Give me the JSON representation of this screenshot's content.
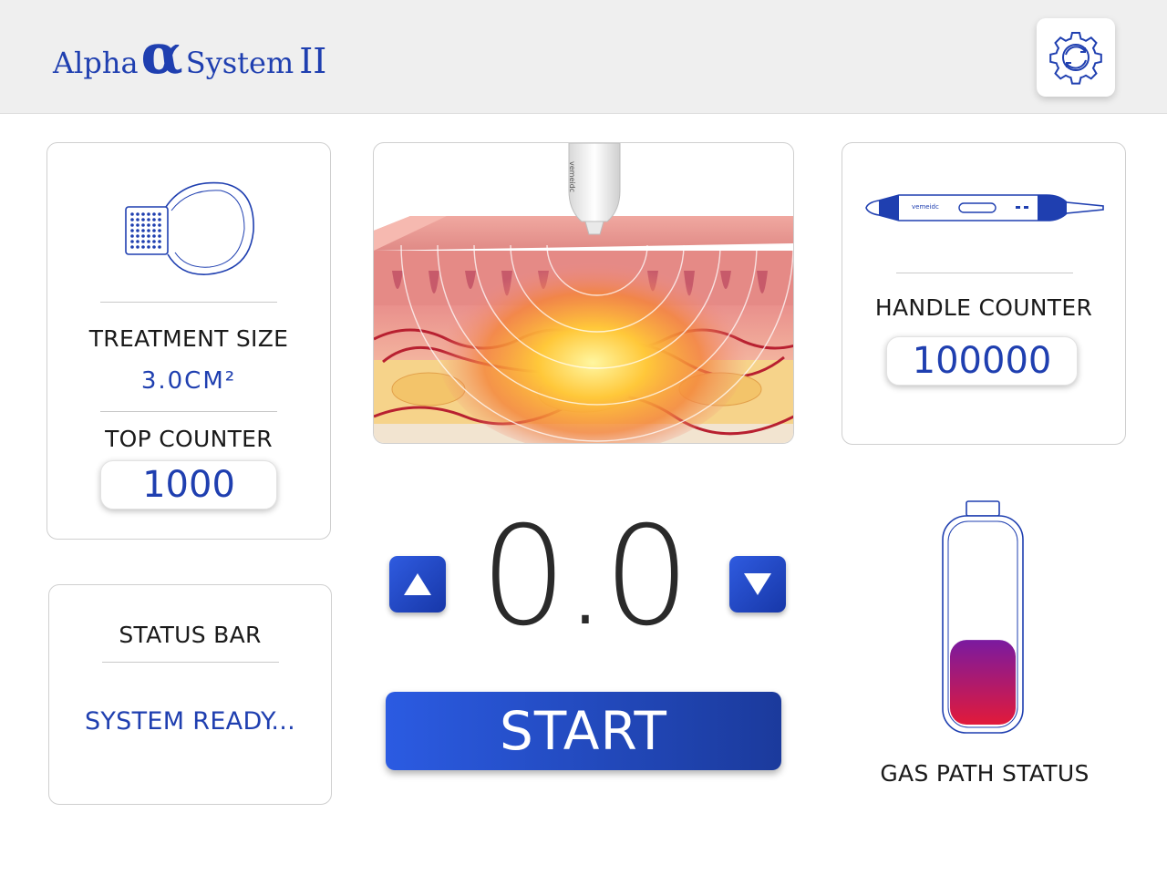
{
  "header": {
    "logo_word1": "Alpha",
    "logo_symbol": "α",
    "logo_word2": "System",
    "logo_numeral": "II",
    "settings_icon": "gear-icon"
  },
  "treatment_card": {
    "tip_icon": "treatment-tip-icon",
    "size_label": "TREATMENT SIZE",
    "size_value": "3.0CM²",
    "top_counter_label": "TOP COUNTER",
    "top_counter_value": "1000"
  },
  "status_card": {
    "label": "STATUS BAR",
    "message": "SYSTEM READY..."
  },
  "skin_illustration": {
    "probe_brand": "vemeidc"
  },
  "handle_card": {
    "handle_brand": "vemeidc",
    "label": "HANDLE COUNTER",
    "value": "100000"
  },
  "controls": {
    "value": "0.0",
    "up_icon": "triangle-up-icon",
    "down_icon": "triangle-down-icon",
    "start_label": "START"
  },
  "gas": {
    "label": "GAS PATH STATUS",
    "level_percent": 42
  },
  "colors": {
    "accent": "#1f3fb0",
    "button_gradient_start": "#2b5be2",
    "button_gradient_end": "#1b3a9c",
    "gas_fill_top": "#7a1aa0",
    "gas_fill_bottom": "#e21a3a"
  }
}
